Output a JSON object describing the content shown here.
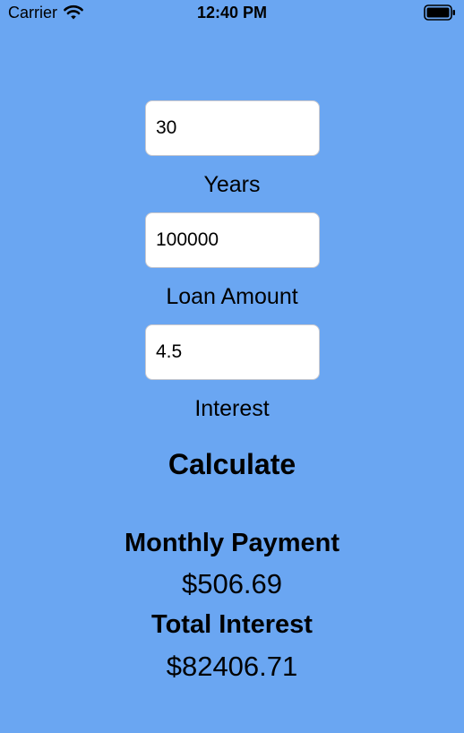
{
  "status_bar": {
    "carrier": "Carrier",
    "time": "12:40 PM",
    "wifi_icon": "wifi-icon",
    "battery_icon": "battery-icon"
  },
  "form": {
    "years": {
      "value": "30",
      "label": "Years"
    },
    "loan_amount": {
      "value": "100000",
      "label": "Loan Amount"
    },
    "interest": {
      "value": "4.5",
      "label": "Interest"
    },
    "calculate_label": "Calculate"
  },
  "results": {
    "monthly_payment_label": "Monthly Payment",
    "monthly_payment_value": "$506.69",
    "total_interest_label": "Total Interest",
    "total_interest_value": "$82406.71"
  },
  "colors": {
    "background": "#6aa6f2",
    "field_background": "#ffffff",
    "text": "#000000"
  }
}
